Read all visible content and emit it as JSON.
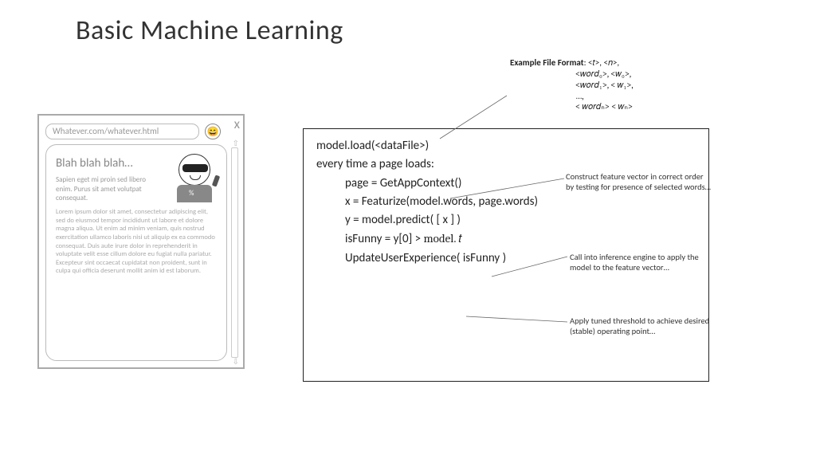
{
  "page": {
    "title": "Basic Machine Learning"
  },
  "browser": {
    "url": "Whatever.com/whatever.html",
    "close": "x",
    "emoji": "😄",
    "heading": "Blah blah blah…",
    "subtext": "Sapien eget mi proin sed libero enim. Purus sit amet volutpat consequat.",
    "lorem": "Lorem ipsum dolor sit amet, consectetur adipiscing elit, sed do eiusmod tempor incididunt ut labore et dolore magna aliqua. Ut enim ad minim veniam, quis nostrud exercitation ullamco laboris nisi ut aliquip ex ea commodo consequat. Duis aute irure dolor in reprehenderit in voluptate velit esse cillum dolore eu fugiat nulla pariatur. Excepteur sint occaecat cupidatat non proident, sunt in culpa qui officia deserunt mollit anim id est laborum.",
    "avatar_percent": "%",
    "scroll_up": "⇧",
    "scroll_down": "⇩"
  },
  "file_format": {
    "label": "Example File Format",
    "line0": ": <𝑡>, <𝑛>,",
    "line1": "<𝑤𝑜𝑟𝑑₀>, <𝑤₀>,",
    "line2": "<𝑤𝑜𝑟𝑑₁>, < 𝑤₁>,",
    "line3": "…,",
    "line4": "< 𝑤𝑜𝑟𝑑ₙ> < 𝑤ₙ>"
  },
  "code": {
    "l1": "model.load(<dataFile>)",
    "l2": "",
    "l3": "every time a page loads:",
    "l4": "page = GetAppContext()",
    "l5": "",
    "l6": "x = Featurize(model.words, page.words)",
    "l7": "",
    "l8": "y = model.predict( [ x ] )",
    "l9": "",
    "l10a": "isFunny = y[0] > ",
    "l10b": "model. 𝑡",
    "l11": "",
    "l12": "UpdateUserExperience( isFunny )"
  },
  "annotations": {
    "a1": "Construct feature vector in correct order by testing for presence of selected words…",
    "a2": "Call into inference engine to apply the model to the feature vector…",
    "a3": "Apply tuned threshold to achieve desired (stable) operating point…"
  }
}
